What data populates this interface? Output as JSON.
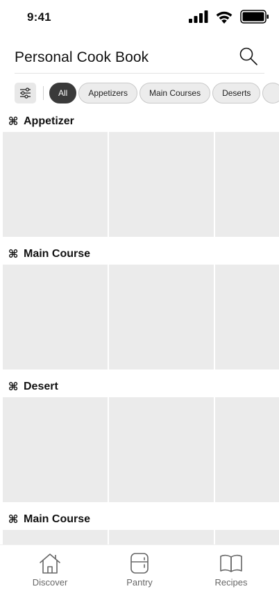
{
  "status_bar": {
    "time": "9:41"
  },
  "header": {
    "title": "Personal Cook Book"
  },
  "filters": {
    "chips": [
      {
        "label": "All",
        "active": true
      },
      {
        "label": "Appetizers",
        "active": false
      },
      {
        "label": "Main Courses",
        "active": false
      },
      {
        "label": "Deserts",
        "active": false
      },
      {
        "label": "",
        "active": false
      }
    ]
  },
  "sections": [
    {
      "title": "Appetizer"
    },
    {
      "title": "Main Course"
    },
    {
      "title": "Desert"
    },
    {
      "title": "Main Course"
    }
  ],
  "section_icon": "⌘",
  "bottom_nav": {
    "items": [
      {
        "label": "Discover",
        "icon": "home-icon"
      },
      {
        "label": "Pantry",
        "icon": "fridge-icon"
      },
      {
        "label": "Recipes",
        "icon": "book-icon"
      }
    ]
  },
  "colors": {
    "chip_active_bg": "#3a3a3a",
    "chip_bg": "#ececec",
    "card_placeholder": "#ebebeb",
    "nav_icon": "#666666"
  }
}
